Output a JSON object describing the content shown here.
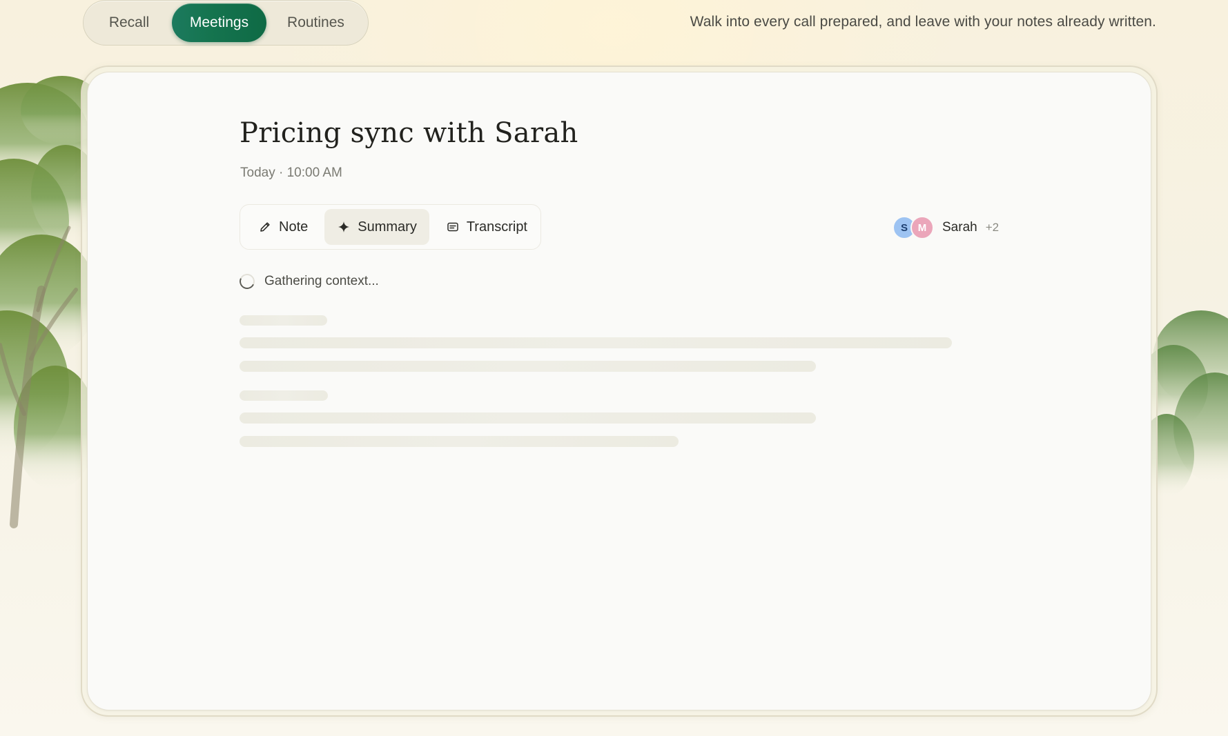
{
  "nav": {
    "tabs": [
      {
        "label": "Recall",
        "active": false
      },
      {
        "label": "Meetings",
        "active": true
      },
      {
        "label": "Routines",
        "active": false
      }
    ],
    "accent_color": "#15744f"
  },
  "tagline": "Walk into every call prepared, and leave with your notes already written.",
  "meeting": {
    "title": "Pricing sync with Sarah",
    "time": "Today · 10:00 AM"
  },
  "view_tabs": [
    {
      "label": "Note",
      "icon": "pencil-icon",
      "active": false
    },
    {
      "label": "Summary",
      "icon": "sparkle-icon",
      "active": true
    },
    {
      "label": "Transcript",
      "icon": "transcript-icon",
      "active": false
    }
  ],
  "participants": {
    "avatars": [
      {
        "initial": "S",
        "color": "#9dc3f2"
      },
      {
        "initial": "M",
        "color": "#eba6ba"
      }
    ],
    "name": "Sarah",
    "more": "+2"
  },
  "status": {
    "text": "Gathering context...",
    "icon": "loading-spinner-icon"
  }
}
